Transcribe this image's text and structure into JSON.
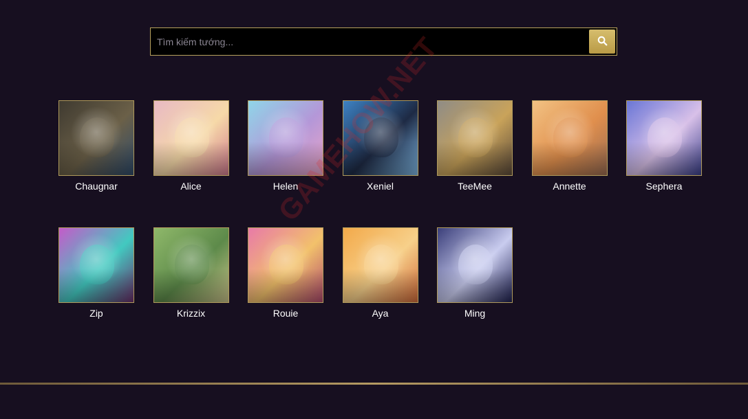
{
  "search": {
    "placeholder": "Tìm kiếm tướng...",
    "value": "",
    "button_icon": "search-icon"
  },
  "accent_color": "#c9ad5b",
  "background_color": "#170f20",
  "watermark": "GAMEHOW.NET",
  "heroes": [
    {
      "name": "Chaugnar",
      "colors": [
        "#3f3a30",
        "#6b6048",
        "#2f4b6a"
      ]
    },
    {
      "name": "Alice",
      "colors": [
        "#e8b9c4",
        "#f6d9a8",
        "#d07a8e"
      ]
    },
    {
      "name": "Helen",
      "colors": [
        "#8fd5e8",
        "#b497d8",
        "#e9a5c8"
      ]
    },
    {
      "name": "Xeniel",
      "colors": [
        "#3d82c4",
        "#1e2a44",
        "#7fb8e6"
      ]
    },
    {
      "name": "TeeMee",
      "colors": [
        "#8f8c86",
        "#c9a35a",
        "#5b4a3a"
      ]
    },
    {
      "name": "Annette",
      "colors": [
        "#f2c283",
        "#e08f4d",
        "#9a6c52"
      ]
    },
    {
      "name": "Sephera",
      "colors": [
        "#6a76d6",
        "#d8c0e8",
        "#3a3f8a"
      ]
    },
    {
      "name": "Zip",
      "colors": [
        "#c45bc9",
        "#42c9c0",
        "#6b2d6a"
      ]
    },
    {
      "name": "Krizzix",
      "colors": [
        "#8fb86a",
        "#5d8a4a",
        "#c9c28a"
      ]
    },
    {
      "name": "Rouie",
      "colors": [
        "#e87aa8",
        "#f2c16b",
        "#b04a6e"
      ]
    },
    {
      "name": "Aya",
      "colors": [
        "#f2a94a",
        "#f7d08a",
        "#d06a3a"
      ]
    },
    {
      "name": "Ming",
      "colors": [
        "#3b3f7a",
        "#c9ccef",
        "#1e2050"
      ]
    }
  ]
}
